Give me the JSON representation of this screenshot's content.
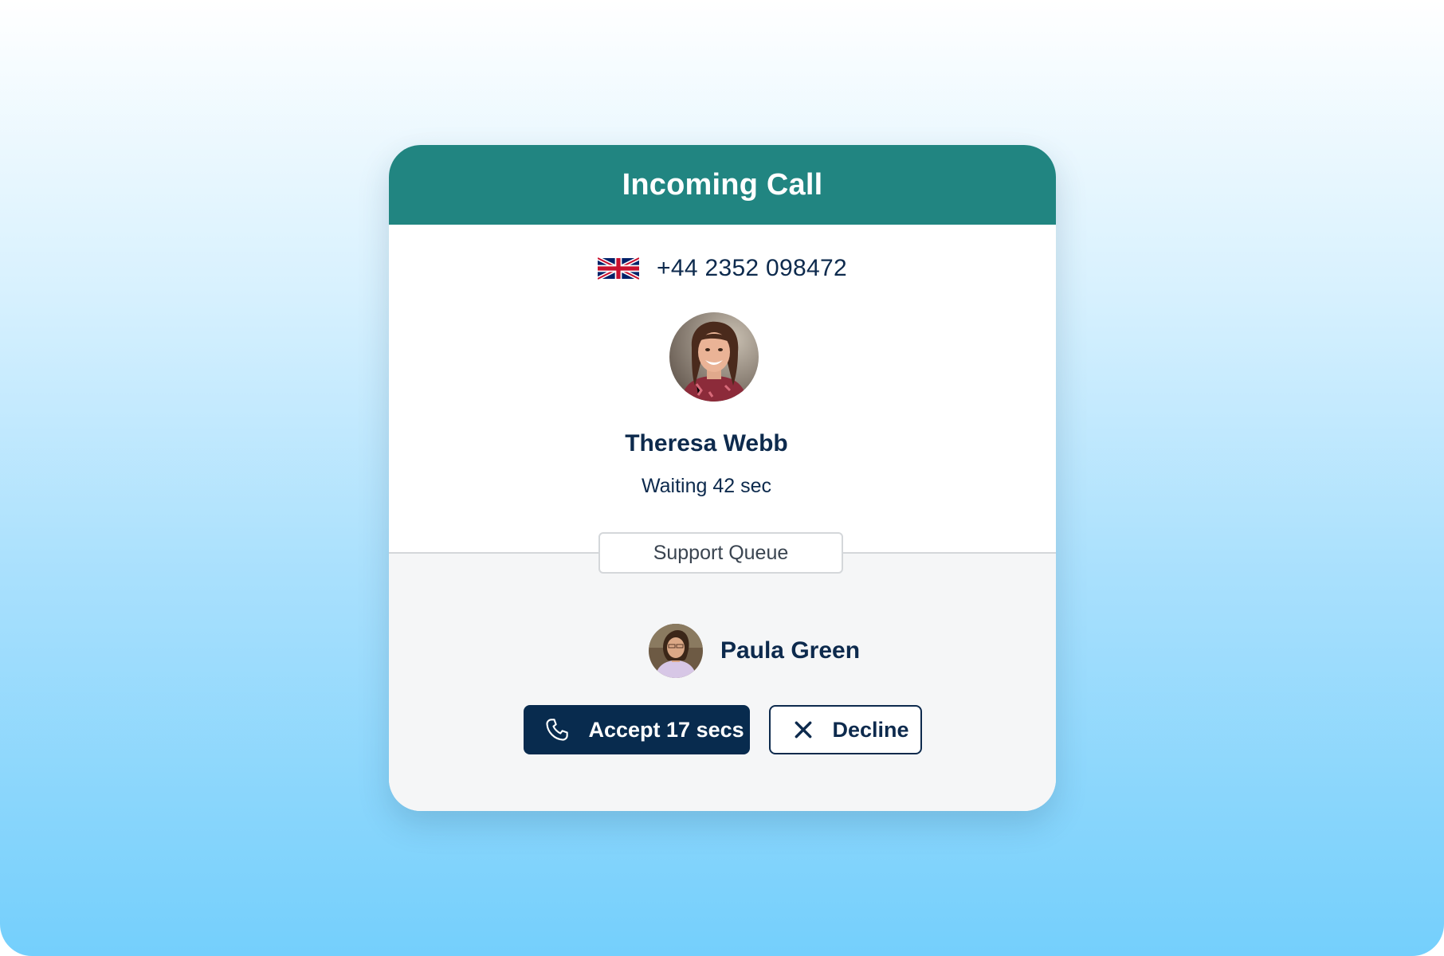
{
  "card": {
    "title": "Incoming Call"
  },
  "caller": {
    "country_flag": "united-kingdom-flag",
    "phone_number": "+44 2352 098472",
    "name": "Theresa Webb",
    "waiting": "Waiting 42 sec"
  },
  "queue": {
    "label": "Support Queue"
  },
  "agent": {
    "name": "Paula Green"
  },
  "actions": {
    "accept_label": "Accept 17 secs",
    "decline_label": "Decline"
  },
  "colors": {
    "header": "#218581",
    "primary_button": "#082b4e",
    "text": "#0d2a4d"
  }
}
